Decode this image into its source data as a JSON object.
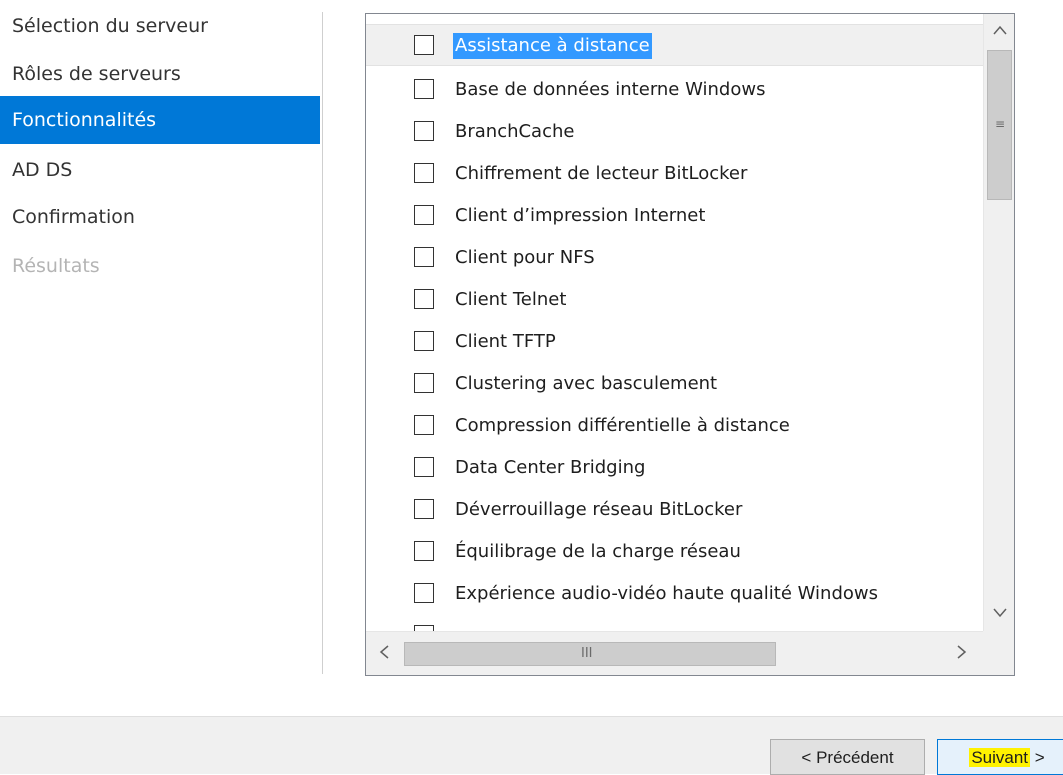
{
  "nav": {
    "items": [
      {
        "label": "Sélection du serveur",
        "state": "normal"
      },
      {
        "label": "Rôles de serveurs",
        "state": "normal"
      },
      {
        "label": "Fonctionnalités",
        "state": "active"
      },
      {
        "label": "AD DS",
        "state": "normal"
      },
      {
        "label": "Confirmation",
        "state": "normal"
      },
      {
        "label": "Résultats",
        "state": "disabled"
      }
    ]
  },
  "features": {
    "items": [
      {
        "label": "Assistance à distance",
        "checked": false,
        "selected": true
      },
      {
        "label": "Base de données interne Windows",
        "checked": false
      },
      {
        "label": "BranchCache",
        "checked": false
      },
      {
        "label": "Chiffrement de lecteur BitLocker",
        "checked": false
      },
      {
        "label": "Client d’impression Internet",
        "checked": false
      },
      {
        "label": "Client pour NFS",
        "checked": false
      },
      {
        "label": "Client Telnet",
        "checked": false
      },
      {
        "label": "Client TFTP",
        "checked": false
      },
      {
        "label": "Clustering avec basculement",
        "checked": false
      },
      {
        "label": "Compression différentielle à distance",
        "checked": false
      },
      {
        "label": "Data Center Bridging",
        "checked": false
      },
      {
        "label": "Déverrouillage réseau BitLocker",
        "checked": false
      },
      {
        "label": "Équilibrage de la charge réseau",
        "checked": false
      },
      {
        "label": "Expérience audio-vidéo haute qualité Windows",
        "checked": false
      }
    ],
    "scrollbar": {
      "up_arrow": "^",
      "down_arrow": "v",
      "left_arrow": "<",
      "right_arrow": ">",
      "v_grip": "≡",
      "h_grip": "III"
    }
  },
  "footer": {
    "prev_label": "< Précédent",
    "next_label": "Suivant",
    "next_suffix": " >"
  },
  "colors": {
    "accent": "#0078d7",
    "selection": "#3399ff",
    "highlight": "#fff200"
  }
}
